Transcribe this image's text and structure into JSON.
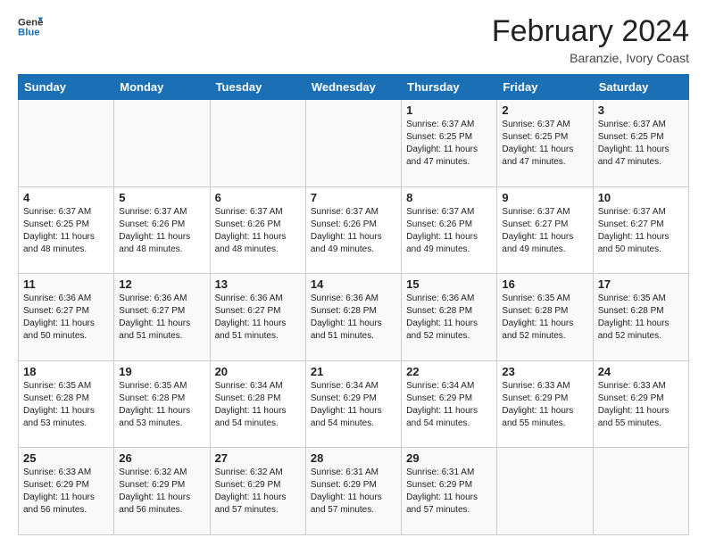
{
  "header": {
    "logo_line1": "General",
    "logo_line2": "Blue",
    "title": "February 2024",
    "subtitle": "Baranzie, Ivory Coast"
  },
  "days_of_week": [
    "Sunday",
    "Monday",
    "Tuesday",
    "Wednesday",
    "Thursday",
    "Friday",
    "Saturday"
  ],
  "weeks": [
    [
      {
        "day": "",
        "info": ""
      },
      {
        "day": "",
        "info": ""
      },
      {
        "day": "",
        "info": ""
      },
      {
        "day": "",
        "info": ""
      },
      {
        "day": "1",
        "info": "Sunrise: 6:37 AM\nSunset: 6:25 PM\nDaylight: 11 hours and 47 minutes."
      },
      {
        "day": "2",
        "info": "Sunrise: 6:37 AM\nSunset: 6:25 PM\nDaylight: 11 hours and 47 minutes."
      },
      {
        "day": "3",
        "info": "Sunrise: 6:37 AM\nSunset: 6:25 PM\nDaylight: 11 hours and 47 minutes."
      }
    ],
    [
      {
        "day": "4",
        "info": "Sunrise: 6:37 AM\nSunset: 6:25 PM\nDaylight: 11 hours and 48 minutes."
      },
      {
        "day": "5",
        "info": "Sunrise: 6:37 AM\nSunset: 6:26 PM\nDaylight: 11 hours and 48 minutes."
      },
      {
        "day": "6",
        "info": "Sunrise: 6:37 AM\nSunset: 6:26 PM\nDaylight: 11 hours and 48 minutes."
      },
      {
        "day": "7",
        "info": "Sunrise: 6:37 AM\nSunset: 6:26 PM\nDaylight: 11 hours and 49 minutes."
      },
      {
        "day": "8",
        "info": "Sunrise: 6:37 AM\nSunset: 6:26 PM\nDaylight: 11 hours and 49 minutes."
      },
      {
        "day": "9",
        "info": "Sunrise: 6:37 AM\nSunset: 6:27 PM\nDaylight: 11 hours and 49 minutes."
      },
      {
        "day": "10",
        "info": "Sunrise: 6:37 AM\nSunset: 6:27 PM\nDaylight: 11 hours and 50 minutes."
      }
    ],
    [
      {
        "day": "11",
        "info": "Sunrise: 6:36 AM\nSunset: 6:27 PM\nDaylight: 11 hours and 50 minutes."
      },
      {
        "day": "12",
        "info": "Sunrise: 6:36 AM\nSunset: 6:27 PM\nDaylight: 11 hours and 51 minutes."
      },
      {
        "day": "13",
        "info": "Sunrise: 6:36 AM\nSunset: 6:27 PM\nDaylight: 11 hours and 51 minutes."
      },
      {
        "day": "14",
        "info": "Sunrise: 6:36 AM\nSunset: 6:28 PM\nDaylight: 11 hours and 51 minutes."
      },
      {
        "day": "15",
        "info": "Sunrise: 6:36 AM\nSunset: 6:28 PM\nDaylight: 11 hours and 52 minutes."
      },
      {
        "day": "16",
        "info": "Sunrise: 6:35 AM\nSunset: 6:28 PM\nDaylight: 11 hours and 52 minutes."
      },
      {
        "day": "17",
        "info": "Sunrise: 6:35 AM\nSunset: 6:28 PM\nDaylight: 11 hours and 52 minutes."
      }
    ],
    [
      {
        "day": "18",
        "info": "Sunrise: 6:35 AM\nSunset: 6:28 PM\nDaylight: 11 hours and 53 minutes."
      },
      {
        "day": "19",
        "info": "Sunrise: 6:35 AM\nSunset: 6:28 PM\nDaylight: 11 hours and 53 minutes."
      },
      {
        "day": "20",
        "info": "Sunrise: 6:34 AM\nSunset: 6:28 PM\nDaylight: 11 hours and 54 minutes."
      },
      {
        "day": "21",
        "info": "Sunrise: 6:34 AM\nSunset: 6:29 PM\nDaylight: 11 hours and 54 minutes."
      },
      {
        "day": "22",
        "info": "Sunrise: 6:34 AM\nSunset: 6:29 PM\nDaylight: 11 hours and 54 minutes."
      },
      {
        "day": "23",
        "info": "Sunrise: 6:33 AM\nSunset: 6:29 PM\nDaylight: 11 hours and 55 minutes."
      },
      {
        "day": "24",
        "info": "Sunrise: 6:33 AM\nSunset: 6:29 PM\nDaylight: 11 hours and 55 minutes."
      }
    ],
    [
      {
        "day": "25",
        "info": "Sunrise: 6:33 AM\nSunset: 6:29 PM\nDaylight: 11 hours and 56 minutes."
      },
      {
        "day": "26",
        "info": "Sunrise: 6:32 AM\nSunset: 6:29 PM\nDaylight: 11 hours and 56 minutes."
      },
      {
        "day": "27",
        "info": "Sunrise: 6:32 AM\nSunset: 6:29 PM\nDaylight: 11 hours and 57 minutes."
      },
      {
        "day": "28",
        "info": "Sunrise: 6:31 AM\nSunset: 6:29 PM\nDaylight: 11 hours and 57 minutes."
      },
      {
        "day": "29",
        "info": "Sunrise: 6:31 AM\nSunset: 6:29 PM\nDaylight: 11 hours and 57 minutes."
      },
      {
        "day": "",
        "info": ""
      },
      {
        "day": "",
        "info": ""
      }
    ]
  ]
}
